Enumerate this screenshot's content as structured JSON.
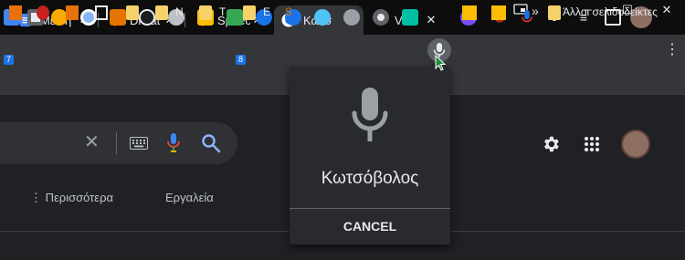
{
  "tabs": [
    {
      "title": "Με Τη",
      "active": false,
      "icon": "docs-icon"
    },
    {
      "title": "Dictat",
      "active": false,
      "icon": "mic-red-icon"
    },
    {
      "title": "Speec",
      "active": false,
      "icon": "mic-blue-icon"
    },
    {
      "title": "Κωτσ",
      "active": true,
      "icon": "google-icon"
    },
    {
      "title": "Vo",
      "active": false,
      "icon": "mic-outline-icon"
    }
  ],
  "extension_badges": {
    "first": "7",
    "second": "8"
  },
  "bookmarks": {
    "letters": [
      "N",
      "T",
      "E",
      "S"
    ],
    "more": "»",
    "other_folder": "Άλλοι σελιδοδείκτες"
  },
  "nav": {
    "more": "⋮ Περισσότερα",
    "tools": "Εργαλεία"
  },
  "voice_popup": {
    "recognized_text": "Κωτσόβολος",
    "cancel_label": "CANCEL"
  }
}
